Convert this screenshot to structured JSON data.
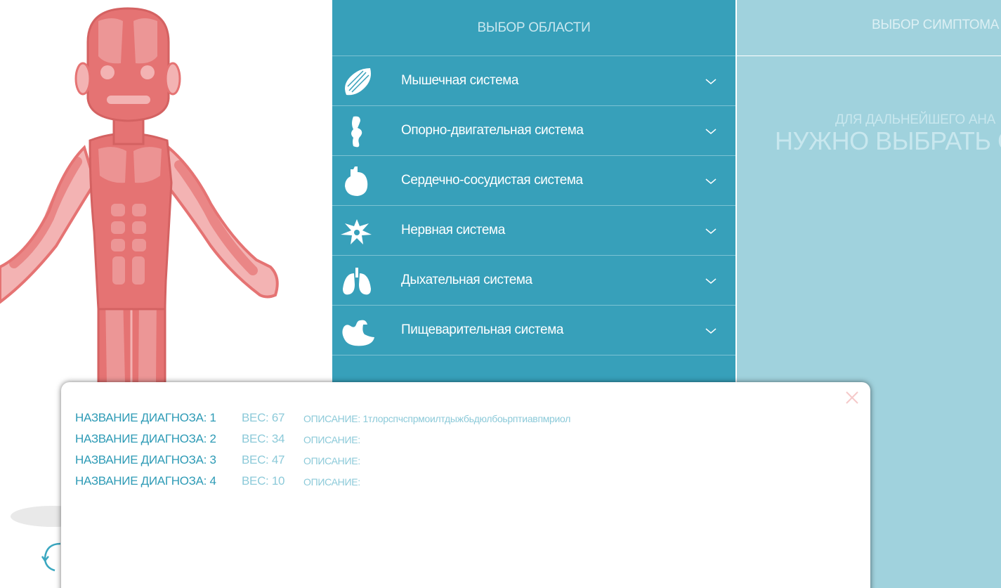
{
  "figure": {
    "image_label": "muscular-body-figure",
    "rotate_icon": "rotate-icon"
  },
  "region_panel": {
    "title": "ВЫБОР ОБЛАСТИ",
    "items": [
      {
        "label": "Мышечная система",
        "icon": "muscle-icon"
      },
      {
        "label": "Опорно-двигательная система",
        "icon": "bone-icon"
      },
      {
        "label": "Сердечно-сосудистая система",
        "icon": "heart-icon"
      },
      {
        "label": "Нервная система",
        "icon": "neuron-icon"
      },
      {
        "label": "Дыхательная система",
        "icon": "lungs-icon"
      },
      {
        "label": "Пищеварительная система",
        "icon": "stomach-icon"
      }
    ]
  },
  "symptom_panel": {
    "title": "ВЫБОР СИМПТОМА",
    "hint_small": "ДЛЯ ДАЛЬНЕЙШЕГО АНА",
    "hint_big": "НУЖНО ВЫБРАТЬ С"
  },
  "modal": {
    "rows": [
      {
        "name": "НАЗВАНИЕ ДИАГНОЗА: 1",
        "weight": "ВЕС: 67",
        "description": "ОПИСАНИЕ: 1тлорспчспрмоилтдыжбьдюлбоьрптиавпмриол"
      },
      {
        "name": "НАЗВАНИЕ ДИАГНОЗА: 2",
        "weight": "ВЕС: 34",
        "description": "ОПИСАНИЕ:"
      },
      {
        "name": "НАЗВАНИЕ ДИАГНОЗА: 3",
        "weight": "ВЕС: 47",
        "description": "ОПИСАНИЕ:"
      },
      {
        "name": "НАЗВАНИЕ ДИАГНОЗА: 4",
        "weight": "ВЕС: 10",
        "description": "ОПИСАНИЕ:"
      }
    ]
  },
  "colors": {
    "panel_dark": "#37a0ba",
    "panel_light": "#a0d2dd",
    "body_red": "#e57373",
    "body_pink": "#f3b3b3",
    "accent_text": "#2e9bb6"
  }
}
